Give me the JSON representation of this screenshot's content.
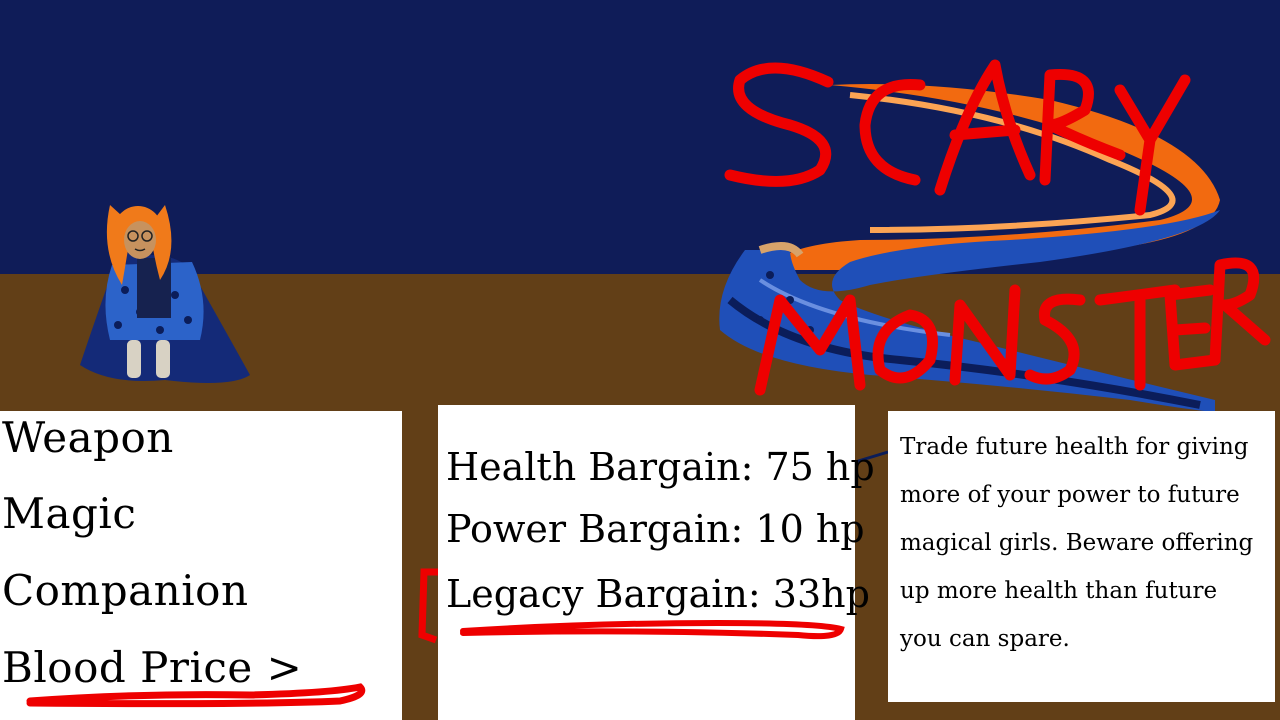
{
  "scene": {
    "sky_color": "#0f1c58",
    "ground_color": "#623f17",
    "monster_label": "SCARY MONSTER",
    "scribble_color": "#ee0000"
  },
  "menu": {
    "items": [
      {
        "label": "Weapon"
      },
      {
        "label": "Magic"
      },
      {
        "label": "Companion"
      },
      {
        "label": "Blood Price >",
        "selected": true
      }
    ]
  },
  "bargains": {
    "items": [
      {
        "label": "Health Bargain: 75 hp"
      },
      {
        "label": "Power Bargain: 10 hp"
      },
      {
        "label": "Legacy Bargain: 33hp",
        "selected": true
      }
    ]
  },
  "description": {
    "text": "Trade future health for giving more of your power to future magical girls. Beware offering up more health than future you can spare."
  }
}
